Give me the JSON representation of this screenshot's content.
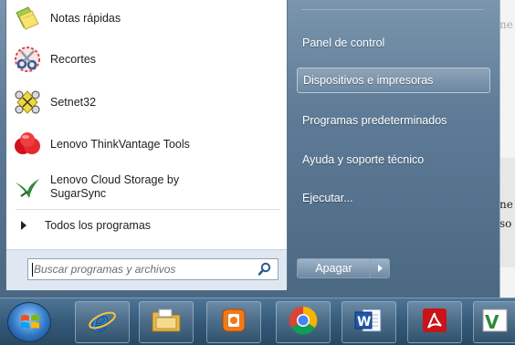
{
  "background_doc": {
    "line1": "ne",
    "line2": "ne",
    "line3": "so"
  },
  "start_menu": {
    "pinned_programs": [
      {
        "label": "Notas rápidas",
        "icon": "sticky-notes-icon"
      },
      {
        "label": "Recortes",
        "icon": "snipping-tool-icon"
      },
      {
        "label": "Setnet32",
        "icon": "setnet32-icon"
      },
      {
        "label": "Lenovo ThinkVantage Tools",
        "icon": "thinkvantage-icon"
      },
      {
        "label": "Lenovo Cloud Storage by SugarSync",
        "icon": "sugarsync-icon"
      }
    ],
    "all_programs_label": "Todos los programas",
    "search_placeholder": "Buscar programas y archivos",
    "right_items": [
      {
        "label": "Panel de control"
      },
      {
        "label": "Dispositivos e impresoras",
        "highlighted": true
      },
      {
        "label": "Programas predeterminados"
      },
      {
        "label": "Ayuda y soporte técnico"
      },
      {
        "label": "Ejecutar..."
      }
    ],
    "shutdown_label": "Apagar"
  },
  "taskbar": {
    "start_button": "windows-orb-icon",
    "apps": [
      {
        "name": "Internet Explorer",
        "icon": "ie-icon"
      },
      {
        "name": "Explorador de Windows",
        "icon": "folder-icon"
      },
      {
        "name": "Lenovo video app",
        "icon": "video-app-icon"
      },
      {
        "name": "Google Chrome",
        "icon": "chrome-icon"
      },
      {
        "name": "Microsoft Word",
        "icon": "word-icon"
      },
      {
        "name": "Adobe Reader",
        "icon": "acrobat-icon"
      },
      {
        "name": "Microsoft Visio",
        "icon": "visio-icon"
      }
    ]
  }
}
